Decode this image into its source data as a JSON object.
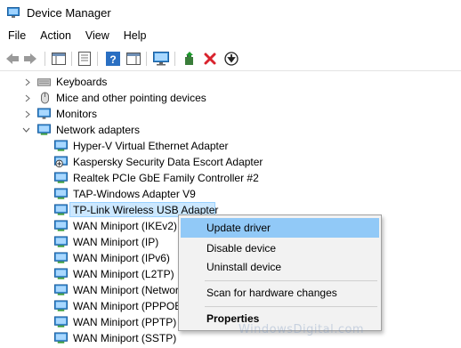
{
  "window": {
    "title": "Device Manager"
  },
  "menubar": [
    "File",
    "Action",
    "View",
    "Help"
  ],
  "toolbar": {
    "buttons": [
      "back-arrow-icon",
      "forward-arrow-icon",
      "show-hide-console-tree-icon",
      "properties-icon",
      "help-icon",
      "action-pane-icon",
      "monitor-icon",
      "update-driver-icon",
      "uninstall-icon",
      "download-icon"
    ]
  },
  "tree": {
    "categories": [
      {
        "label": "Keyboards",
        "expanded": false
      },
      {
        "label": "Mice and other pointing devices",
        "expanded": false
      },
      {
        "label": "Monitors",
        "expanded": false
      },
      {
        "label": "Network adapters",
        "expanded": true
      }
    ],
    "devices": [
      "Hyper-V Virtual Ethernet Adapter",
      "Kaspersky Security Data Escort Adapter",
      "Realtek PCIe GbE Family Controller #2",
      "TAP-Windows Adapter V9",
      "TP-Link Wireless USB Adapter",
      "WAN Miniport (IKEv2)",
      "WAN Miniport (IP)",
      "WAN Miniport (IPv6)",
      "WAN Miniport (L2TP)",
      "WAN Miniport (Network Monitor)",
      "WAN Miniport (PPPOE)",
      "WAN Miniport (PPTP)",
      "WAN Miniport (SSTP)"
    ],
    "selected_index": 4
  },
  "context_menu": {
    "items": [
      "Update driver",
      "Disable device",
      "Uninstall device",
      "Scan for hardware changes",
      "Properties"
    ],
    "highlighted": "Update driver"
  },
  "watermark": "WindowsDigital.com",
  "colors": {
    "selection": "#cce8ff",
    "menu_highlight": "#91c9f7",
    "accent_red": "#d9232d",
    "accent_blue": "#2a6fc2"
  }
}
